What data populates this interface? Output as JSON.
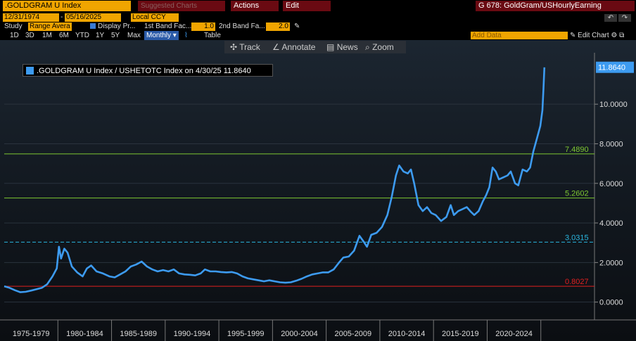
{
  "toolbar_top": {
    "ticker": ".GOLDGRAM U Index",
    "suggested": "Suggested Charts",
    "actions": "Actions",
    "edit": "Edit",
    "graph_title": "G 678: GoldGram/USHourlyEarning"
  },
  "date_bar": {
    "start_date": "12/31/1974",
    "end_date": "05/16/2025",
    "currency": "Local CCY"
  },
  "study_bar": {
    "study_label": "Study",
    "study_value": "Range Avera",
    "display_label": "Display Pr...",
    "band1_label": "1st Band Fac...",
    "band1_value": "1.0",
    "band2_label": "2nd Band Fa...",
    "band2_value": "2.0"
  },
  "range_bar": {
    "ranges": [
      "1D",
      "3D",
      "1M",
      "6M",
      "YTD",
      "1Y",
      "5Y",
      "Max"
    ],
    "frequency": "Monthly",
    "table_label": "Table",
    "add_data_placeholder": "Add Data",
    "edit_chart": "Edit Chart"
  },
  "chart_toolbar": {
    "track": "Track",
    "annotate": "Annotate",
    "news": "News",
    "zoom": "Zoom"
  },
  "legend": {
    "text": ".GOLDGRAM U Index / USHETOTC Index on 4/30/25 11.8640"
  },
  "colors": {
    "series": "#3d9bf0",
    "green_bands": "#7ec832",
    "red_band": "#e02020",
    "cyan_band": "#2ab7e0",
    "accent": "#f0a500"
  },
  "chart_data": {
    "type": "line",
    "title": ".GOLDGRAM U Index / USHETOTC Index",
    "x_labels": [
      "1975-1979",
      "1980-1984",
      "1985-1989",
      "1990-1994",
      "1995-1999",
      "2000-2004",
      "2005-2009",
      "2010-2014",
      "2015-2019",
      "2020-2024"
    ],
    "y_ticks": [
      "0.0000",
      "2.0000",
      "4.0000",
      "6.0000",
      "8.0000",
      "10.0000"
    ],
    "ylim": [
      -0.9,
      12.6
    ],
    "last_value": "11.8640",
    "reference_lines": [
      {
        "value": 7.489,
        "label": "7.4890",
        "color": "#7ec832",
        "style": "solid"
      },
      {
        "value": 5.2602,
        "label": "5.2602",
        "color": "#7ec832",
        "style": "solid"
      },
      {
        "value": 3.0315,
        "label": "3.0315",
        "color": "#2ab7e0",
        "style": "dashed"
      },
      {
        "value": 0.8027,
        "label": "0.8027",
        "color": "#e02020",
        "style": "solid"
      }
    ],
    "series": [
      {
        "points": [
          [
            1975.0,
            0.8
          ],
          [
            1975.5,
            0.72
          ],
          [
            1976.0,
            0.6
          ],
          [
            1976.5,
            0.5
          ],
          [
            1977.0,
            0.52
          ],
          [
            1977.5,
            0.58
          ],
          [
            1978.0,
            0.65
          ],
          [
            1978.5,
            0.72
          ],
          [
            1979.0,
            0.9
          ],
          [
            1979.5,
            1.3
          ],
          [
            1979.9,
            1.7
          ],
          [
            1980.1,
            2.8
          ],
          [
            1980.3,
            2.2
          ],
          [
            1980.6,
            2.7
          ],
          [
            1980.9,
            2.5
          ],
          [
            1981.3,
            1.8
          ],
          [
            1981.8,
            1.5
          ],
          [
            1982.3,
            1.3
          ],
          [
            1982.7,
            1.7
          ],
          [
            1983.1,
            1.85
          ],
          [
            1983.6,
            1.55
          ],
          [
            1984.2,
            1.45
          ],
          [
            1984.8,
            1.3
          ],
          [
            1985.3,
            1.25
          ],
          [
            1985.8,
            1.4
          ],
          [
            1986.3,
            1.55
          ],
          [
            1986.8,
            1.8
          ],
          [
            1987.3,
            1.9
          ],
          [
            1987.8,
            2.05
          ],
          [
            1988.3,
            1.8
          ],
          [
            1988.8,
            1.65
          ],
          [
            1989.3,
            1.55
          ],
          [
            1989.8,
            1.62
          ],
          [
            1990.3,
            1.55
          ],
          [
            1990.8,
            1.65
          ],
          [
            1991.3,
            1.45
          ],
          [
            1991.8,
            1.4
          ],
          [
            1992.3,
            1.38
          ],
          [
            1992.8,
            1.35
          ],
          [
            1993.3,
            1.45
          ],
          [
            1993.7,
            1.65
          ],
          [
            1994.2,
            1.55
          ],
          [
            1994.7,
            1.55
          ],
          [
            1995.2,
            1.52
          ],
          [
            1995.7,
            1.5
          ],
          [
            1996.2,
            1.52
          ],
          [
            1996.7,
            1.45
          ],
          [
            1997.2,
            1.3
          ],
          [
            1997.7,
            1.2
          ],
          [
            1998.2,
            1.15
          ],
          [
            1998.7,
            1.1
          ],
          [
            1999.2,
            1.05
          ],
          [
            1999.7,
            1.1
          ],
          [
            2000.2,
            1.05
          ],
          [
            2000.7,
            1.0
          ],
          [
            2001.2,
            0.98
          ],
          [
            2001.7,
            1.0
          ],
          [
            2002.2,
            1.08
          ],
          [
            2002.7,
            1.18
          ],
          [
            2003.2,
            1.3
          ],
          [
            2003.7,
            1.4
          ],
          [
            2004.2,
            1.45
          ],
          [
            2004.7,
            1.5
          ],
          [
            2005.2,
            1.5
          ],
          [
            2005.7,
            1.65
          ],
          [
            2006.2,
            2.0
          ],
          [
            2006.6,
            2.25
          ],
          [
            2007.1,
            2.3
          ],
          [
            2007.6,
            2.6
          ],
          [
            2008.1,
            3.35
          ],
          [
            2008.5,
            3.05
          ],
          [
            2008.8,
            2.8
          ],
          [
            2009.2,
            3.4
          ],
          [
            2009.7,
            3.5
          ],
          [
            2010.2,
            3.8
          ],
          [
            2010.7,
            4.4
          ],
          [
            2011.1,
            5.3
          ],
          [
            2011.5,
            6.4
          ],
          [
            2011.8,
            6.9
          ],
          [
            2012.2,
            6.6
          ],
          [
            2012.6,
            6.5
          ],
          [
            2012.9,
            6.7
          ],
          [
            2013.2,
            6.0
          ],
          [
            2013.6,
            4.9
          ],
          [
            2014.0,
            4.6
          ],
          [
            2014.4,
            4.8
          ],
          [
            2014.8,
            4.5
          ],
          [
            2015.2,
            4.4
          ],
          [
            2015.7,
            4.1
          ],
          [
            2016.2,
            4.3
          ],
          [
            2016.6,
            4.9
          ],
          [
            2016.9,
            4.4
          ],
          [
            2017.3,
            4.6
          ],
          [
            2017.7,
            4.7
          ],
          [
            2018.1,
            4.8
          ],
          [
            2018.5,
            4.55
          ],
          [
            2018.8,
            4.4
          ],
          [
            2019.2,
            4.6
          ],
          [
            2019.6,
            5.1
          ],
          [
            2019.9,
            5.4
          ],
          [
            2020.2,
            5.8
          ],
          [
            2020.5,
            6.8
          ],
          [
            2020.8,
            6.6
          ],
          [
            2021.1,
            6.2
          ],
          [
            2021.5,
            6.3
          ],
          [
            2021.9,
            6.4
          ],
          [
            2022.2,
            6.6
          ],
          [
            2022.6,
            6.0
          ],
          [
            2022.9,
            5.9
          ],
          [
            2023.3,
            6.7
          ],
          [
            2023.7,
            6.6
          ],
          [
            2024.0,
            6.8
          ],
          [
            2024.3,
            7.6
          ],
          [
            2024.7,
            8.4
          ],
          [
            2024.95,
            8.9
          ],
          [
            2025.15,
            9.7
          ],
          [
            2025.25,
            10.8
          ],
          [
            2025.33,
            11.86
          ]
        ]
      }
    ]
  }
}
